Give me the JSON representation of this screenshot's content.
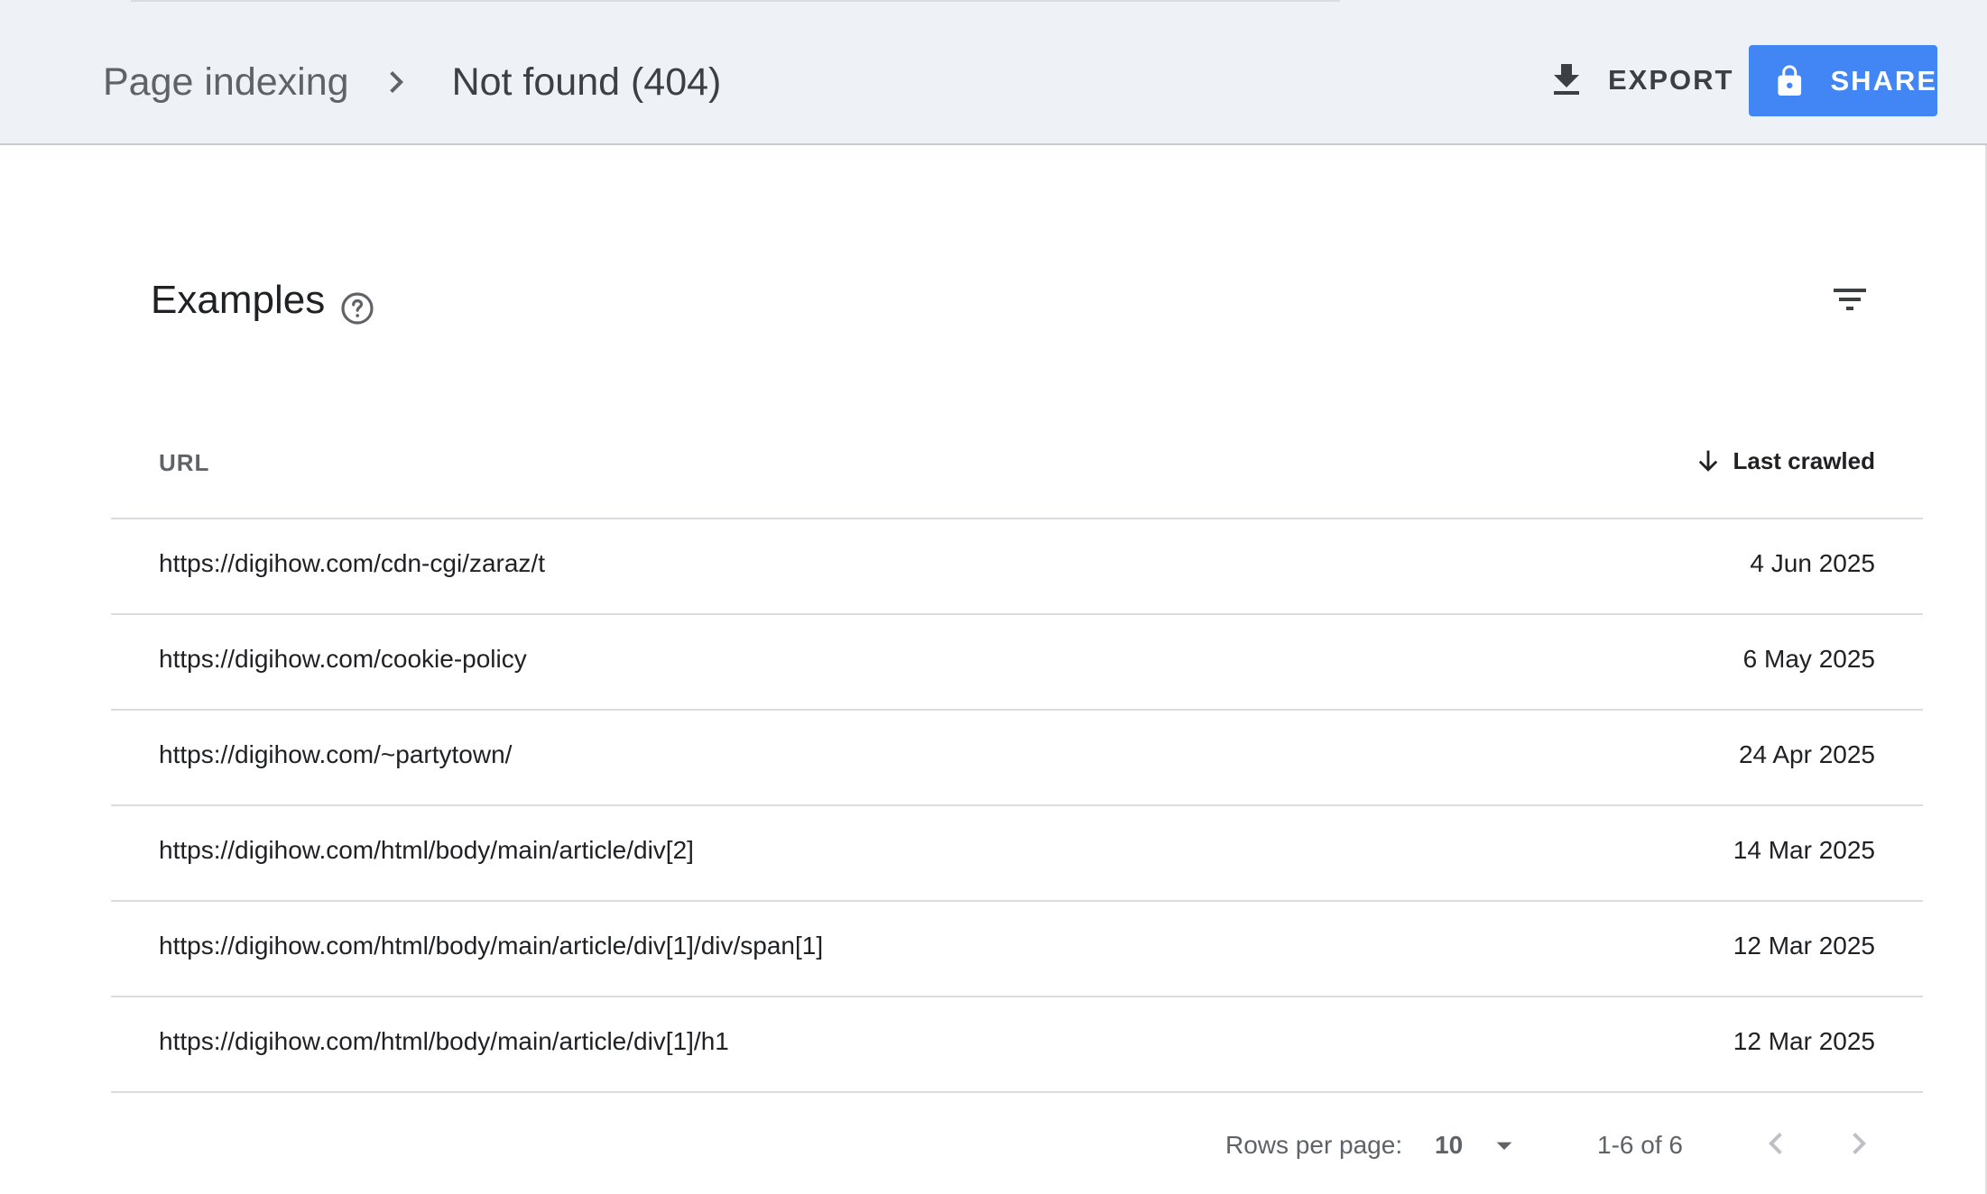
{
  "header": {
    "breadcrumb_root": "Page indexing",
    "breadcrumb_current": "Not found (404)",
    "export_label": "EXPORT",
    "share_label": "SHARE"
  },
  "section": {
    "title": "Examples"
  },
  "table": {
    "columns": {
      "url": "URL",
      "last_crawled": "Last crawled"
    },
    "rows": [
      {
        "url": "https://digihow.com/cdn-cgi/zaraz/t",
        "date": "4 Jun 2025"
      },
      {
        "url": "https://digihow.com/cookie-policy",
        "date": "6 May 2025"
      },
      {
        "url": "https://digihow.com/~partytown/",
        "date": "24 Apr 2025"
      },
      {
        "url": "https://digihow.com/html/body/main/article/div[2]",
        "date": "14 Mar 2025"
      },
      {
        "url": "https://digihow.com/html/body/main/article/div[1]/div/span[1]",
        "date": "12 Mar 2025"
      },
      {
        "url": "https://digihow.com/html/body/main/article/div[1]/h1",
        "date": "12 Mar 2025"
      }
    ]
  },
  "pagination": {
    "rows_per_page_label": "Rows per page:",
    "rows_per_page_value": "10",
    "range_label": "1-6 of 6"
  },
  "icons": {
    "breadcrumb_separator": "chevron-right-icon",
    "export": "download-icon",
    "share": "lock-icon",
    "help": "help-circle-icon",
    "filter": "filter-icon",
    "sort": "arrow-down-icon",
    "rows_dropdown": "caret-down-icon",
    "prev_page": "chevron-left-icon",
    "next_page": "chevron-right-icon"
  },
  "colors": {
    "header_bg": "#eef2f7",
    "share_button": "#4285f4",
    "divider": "#dadce0",
    "muted_text": "#5f6368"
  }
}
